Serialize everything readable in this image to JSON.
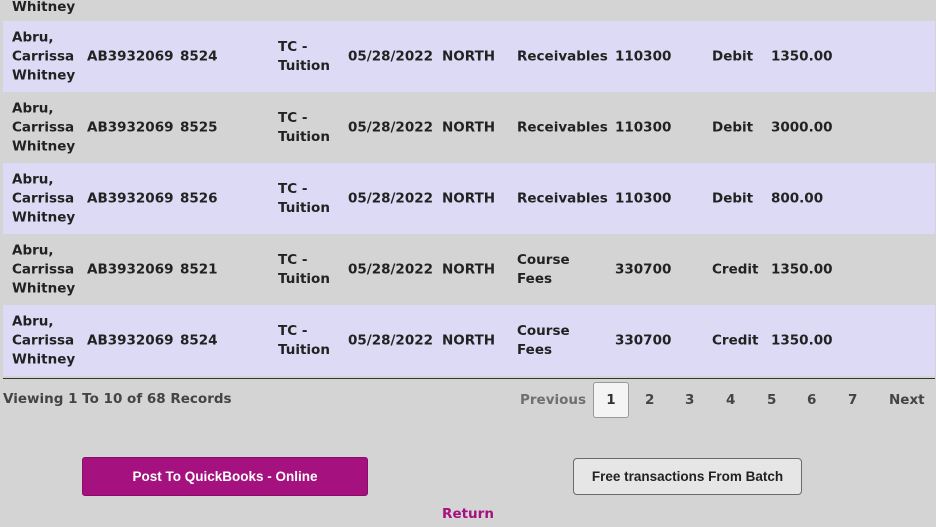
{
  "table": {
    "partial_row_name": "Whitney",
    "rows": [
      {
        "name": "Abru,\nCarrissa\nWhitney",
        "id": "AB3932069",
        "number": "8524",
        "type": "TC -\nTuition",
        "date": "05/28/2022",
        "region": "NORTH",
        "account": "Receivables",
        "code": "110300",
        "direction": "Debit",
        "amount": "1350.00"
      },
      {
        "name": "Abru,\nCarrissa\nWhitney",
        "id": "AB3932069",
        "number": "8525",
        "type": "TC -\nTuition",
        "date": "05/28/2022",
        "region": "NORTH",
        "account": "Receivables",
        "code": "110300",
        "direction": "Debit",
        "amount": "3000.00"
      },
      {
        "name": "Abru,\nCarrissa\nWhitney",
        "id": "AB3932069",
        "number": "8526",
        "type": "TC -\nTuition",
        "date": "05/28/2022",
        "region": "NORTH",
        "account": "Receivables",
        "code": "110300",
        "direction": "Debit",
        "amount": "800.00"
      },
      {
        "name": "Abru,\nCarrissa\nWhitney",
        "id": "AB3932069",
        "number": "8521",
        "type": "TC -\nTuition",
        "date": "05/28/2022",
        "region": "NORTH",
        "account": "Course\nFees",
        "code": "330700",
        "direction": "Credit",
        "amount": "1350.00"
      },
      {
        "name": "Abru,\nCarrissa\nWhitney",
        "id": "AB3932069",
        "number": "8524",
        "type": "TC -\nTuition",
        "date": "05/28/2022",
        "region": "NORTH",
        "account": "Course\nFees",
        "code": "330700",
        "direction": "Credit",
        "amount": "1350.00"
      }
    ]
  },
  "footer": {
    "records_text": "Viewing 1 To 10 of 68 Records"
  },
  "pagination": {
    "previous_label": "Previous",
    "next_label": "Next",
    "current_page": "1",
    "pages": [
      "1",
      "2",
      "3",
      "4",
      "5",
      "6",
      "7"
    ]
  },
  "actions": {
    "post_label": "Post To QuickBooks - Online",
    "free_label": "Free transactions From Batch",
    "return_label": "Return"
  },
  "colors": {
    "accent": "#a5117e",
    "row_highlight": "#dcdaf4",
    "background": "#d4d4d4"
  }
}
